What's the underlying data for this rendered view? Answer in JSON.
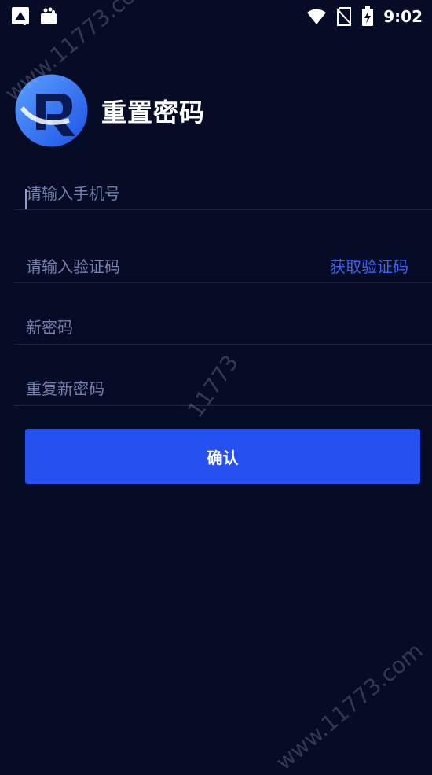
{
  "status_bar": {
    "time": "9:02",
    "icons": [
      "app-icon",
      "bag-icon",
      "wifi-icon",
      "no-sim-icon",
      "battery-charging-icon"
    ]
  },
  "header": {
    "title": "重置密码",
    "logo_icon": "app-logo-icon"
  },
  "form": {
    "phone_placeholder": "请输入手机号",
    "code_placeholder": "请输入验证码",
    "get_code_label": "获取验证码",
    "new_password_placeholder": "新密码",
    "repeat_password_placeholder": "重复新密码"
  },
  "confirm_label": "确认",
  "colors": {
    "background": "#070c26",
    "accent": "#2551f0",
    "link": "#3d63f0",
    "placeholder": "#7480ad"
  },
  "watermarks": [
    "www.11773.com",
    "11773",
    "www.11773.com"
  ]
}
